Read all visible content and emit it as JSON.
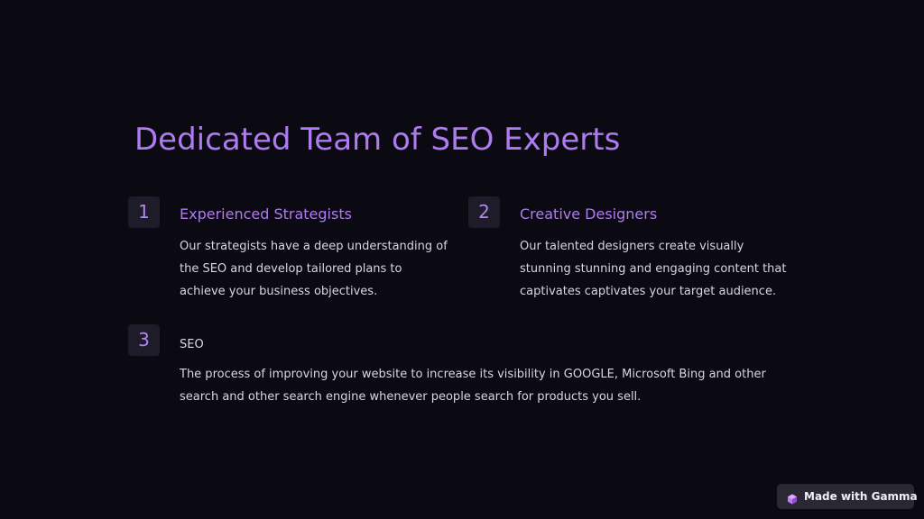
{
  "title": "Dedicated Team of SEO Experts",
  "items": [
    {
      "number": "1",
      "heading": "Experienced Strategists",
      "body": "Our strategists have a deep understanding of the SEO and develop tailored plans to achieve your business objectives."
    },
    {
      "number": "2",
      "heading": "Creative Designers",
      "body": "Our talented designers create visually stunning stunning and engaging content that captivates captivates your target audience."
    },
    {
      "number": "3",
      "heading": "SEO",
      "body": "The process of improving your website to increase its visibility in GOOGLE, Microsoft Bing and other search and other search engine whenever people search for products you sell."
    }
  ],
  "badge": {
    "label": "Made with Gamma",
    "icon": "gamma-logo-icon"
  },
  "colors": {
    "background": "#0b0a12",
    "accent": "#ae7bf0",
    "number_box": "#1e1c29",
    "body_text": "#d8d6e0"
  }
}
